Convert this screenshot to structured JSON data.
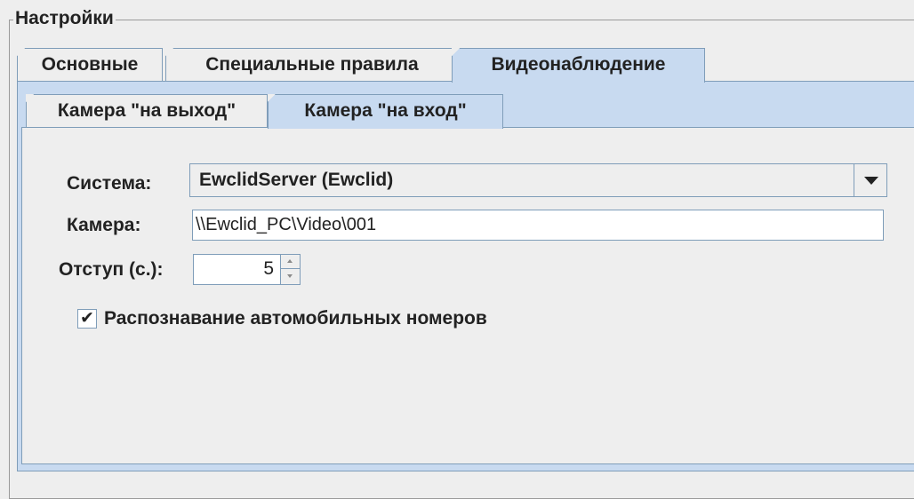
{
  "group": {
    "title": "Настройки"
  },
  "outer_tabs": [
    {
      "label": "Основные",
      "selected": false
    },
    {
      "label": "Специальные правила",
      "selected": false
    },
    {
      "label": "Видеонаблюдение",
      "selected": true
    }
  ],
  "inner_tabs": [
    {
      "label": "Камера \"на выход\"",
      "selected": false
    },
    {
      "label": "Камера \"на вход\"",
      "selected": true
    }
  ],
  "form": {
    "system_label": "Система:",
    "system_value": "EwclidServer (Ewclid)",
    "camera_label": "Камера:",
    "camera_value": "\\\\Ewclid_PC\\Video\\001",
    "offset_label": "Отступ (с.):",
    "offset_value": "5",
    "plate_recognition_label": "Распознавание автомобильных номеров",
    "plate_recognition_checked": true
  },
  "colors": {
    "accent": "#c8daf0",
    "border": "#7f9db9",
    "background": "#eeeeee"
  },
  "icons": {
    "combo_arrow": "chevron-down-icon",
    "spinner_up": "spinner-up-icon",
    "spinner_down": "spinner-down-icon",
    "check": "checkmark-icon"
  }
}
